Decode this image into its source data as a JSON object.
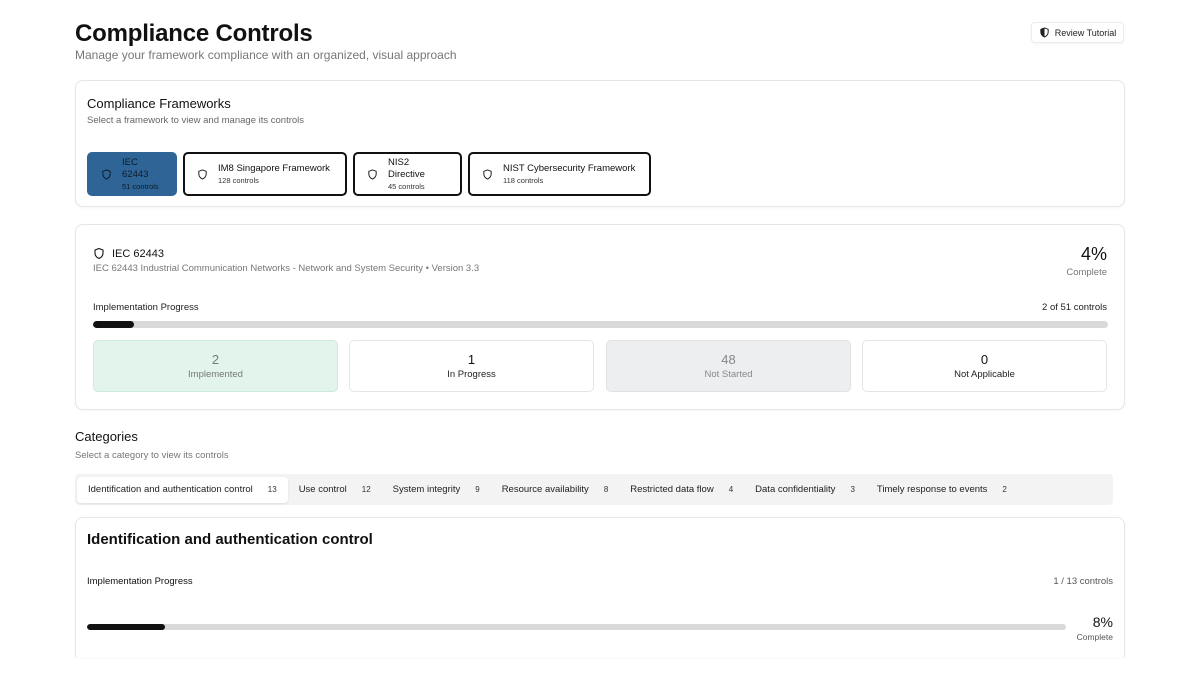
{
  "header": {
    "title": "Compliance Controls",
    "subtitle": "Manage your framework compliance with an organized, visual approach",
    "tutorial_label": "Review Tutorial"
  },
  "frameworks": {
    "title": "Compliance Frameworks",
    "subtitle": "Select a framework to view and manage its controls",
    "items": [
      {
        "name": "IEC 62443",
        "count": "51 controls",
        "selected": true
      },
      {
        "name": "IM8 Singapore Framework",
        "count": "128 controls",
        "selected": false
      },
      {
        "name": "NIS2 Directive",
        "count": "45 controls",
        "selected": false
      },
      {
        "name": "NIST Cybersecurity Framework",
        "count": "118 controls",
        "selected": false
      }
    ]
  },
  "framework_detail": {
    "name": "IEC 62443",
    "description": "IEC 62443 Industrial Communication Networks - Network and System Security • Version 3.3",
    "percent": "4%",
    "percent_label": "Complete",
    "progress_label": "Implementation Progress",
    "progress_count": "2 of 51 controls",
    "progress_fraction": 0.04,
    "stats": {
      "implemented": {
        "value": "2",
        "label": "Implemented"
      },
      "in_progress": {
        "value": "1",
        "label": "In Progress"
      },
      "not_started": {
        "value": "48",
        "label": "Not Started"
      },
      "not_applicable": {
        "value": "0",
        "label": "Not Applicable"
      }
    }
  },
  "categories": {
    "title": "Categories",
    "subtitle": "Select a category to view its controls",
    "tabs": [
      {
        "label": "Identification and authentication control",
        "count": "13",
        "active": true
      },
      {
        "label": "Use control",
        "count": "12",
        "active": false
      },
      {
        "label": "System integrity",
        "count": "9",
        "active": false
      },
      {
        "label": "Resource availability",
        "count": "8",
        "active": false
      },
      {
        "label": "Restricted data flow",
        "count": "4",
        "active": false
      },
      {
        "label": "Data confidentiality",
        "count": "3",
        "active": false
      },
      {
        "label": "Timely response to events",
        "count": "2",
        "active": false
      }
    ]
  },
  "category_detail": {
    "title": "Identification and authentication control",
    "progress_label": "Implementation Progress",
    "progress_count": "1 / 13 controls",
    "percent": "8%",
    "percent_label": "Complete",
    "progress_fraction": 0.08
  },
  "colors": {
    "selected_framework": "#2f6596",
    "implemented_bg": "#e3f4ec",
    "not_started_bg": "#eceeef",
    "progress_fill": "#111111"
  }
}
